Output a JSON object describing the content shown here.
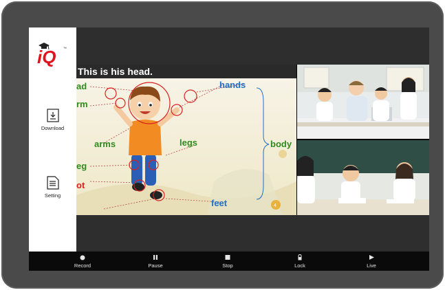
{
  "sidebar": {
    "logo_text": "iQ",
    "logo_tm": "™",
    "download_label": "Download",
    "setting_label": "Setting"
  },
  "slide": {
    "title": "This is his head.",
    "labels": {
      "head": "ad",
      "arm": "rm",
      "arms": "arms",
      "leg": "eg",
      "foot": "ot",
      "hands": "hands",
      "legs": "legs",
      "body": "body",
      "feet": "feet"
    },
    "page_badge": "4"
  },
  "toolbar": {
    "record_label": "Record",
    "pause_label": "Pause",
    "stop_label": "Stop",
    "lock_label": "Lock",
    "live_label": "Live"
  },
  "colors": {
    "label_blue": "#1f6fc4",
    "label_green": "#2f8a1c",
    "circle_red": "#d92020",
    "logo_red": "#e0141e"
  }
}
